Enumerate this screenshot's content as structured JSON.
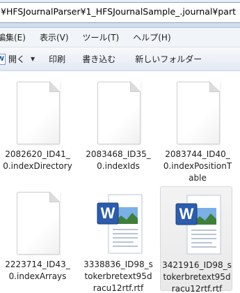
{
  "address": {
    "path": "¥HFSJournalParser¥1_HFSJournalSample_.journal¥part"
  },
  "menu": {
    "items": [
      "編集(E)",
      "表示(V)",
      "ツール(T)",
      "ヘルプ(H)"
    ]
  },
  "toolbar": {
    "open_label": "開く",
    "print_label": "印刷",
    "burn_label": "書き込む",
    "new_folder_label": "新しいフォルダー"
  },
  "files": [
    {
      "name": "2082620_ID41_0.indexDirectory",
      "type": "generic",
      "selected": false
    },
    {
      "name": "2083468_ID35_0.indexIds",
      "type": "generic",
      "selected": false
    },
    {
      "name": "2083744_ID40_0.indexPositionTable",
      "type": "generic",
      "selected": false
    },
    {
      "name": "2223714_ID43_0.indexArrays",
      "type": "generic",
      "selected": false
    },
    {
      "name": "3338836_ID98_stokerbretext95dracu12rtf.rtf",
      "type": "word",
      "selected": false
    },
    {
      "name": "3421916_ID98_stokerbretext95dracu12rtf.rtf",
      "type": "word",
      "selected": true
    }
  ],
  "colors": {
    "word_blue": "#2b5cae",
    "selection_bg": "#ececec"
  }
}
